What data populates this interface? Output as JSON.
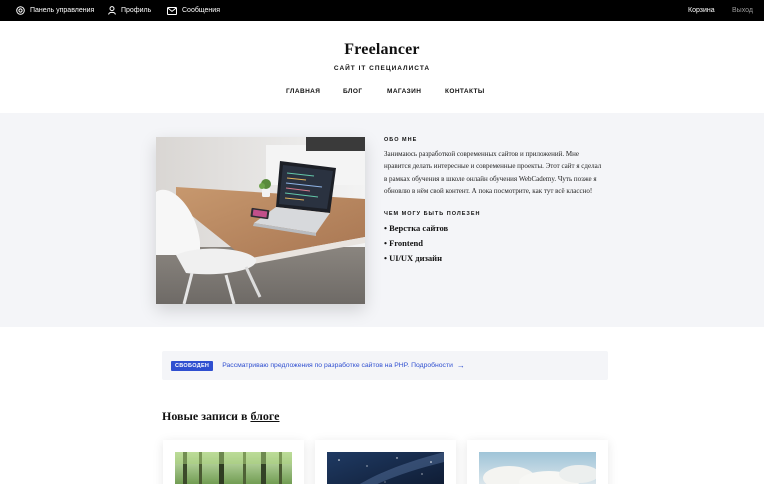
{
  "topbar": {
    "dashboard": "Панель управления",
    "profile": "Профиль",
    "messages": "Сообщения",
    "cart": "Корзина",
    "logout": "Выход"
  },
  "header": {
    "title": "Freelancer",
    "subtitle": "САЙТ IT СПЕЦИАЛИСТА",
    "nav": [
      "ГЛАВНАЯ",
      "БЛОГ",
      "МАГАЗИН",
      "КОНТАКТЫ"
    ]
  },
  "about": {
    "label": "ОБО МНЕ",
    "text": "Занимаюсь разработкой современных сайтов и приложений. Мне нравится делать интересные и современные проекты. Этот сайт я сделал в рамках обучения в школе онлайн обучения WebCademy. Чуть позже я обновлю в нём свой контент. А пока посмотрите, как тут всё классно!",
    "skills_label": "ЧЕМ МОГУ БЫТЬ ПОЛЕЗЕН",
    "skills": [
      "• Верстка сайтов",
      "• Frontend",
      "• UI/UX дизайн"
    ]
  },
  "notice": {
    "badge": "СВОБОДЕН",
    "text": "Рассматриваю предложения по разработке сайтов на PHP. Подробности",
    "arrow": "→"
  },
  "blog": {
    "heading_prefix": "Новые записи в",
    "heading_link": "блоге"
  },
  "colors": {
    "accent": "#2f4fd0",
    "topbar": "#000000",
    "section_bg": "#f4f5f8"
  },
  "icons": {
    "dashboard": "dashboard-icon",
    "profile": "user-icon",
    "messages": "mail-icon"
  }
}
